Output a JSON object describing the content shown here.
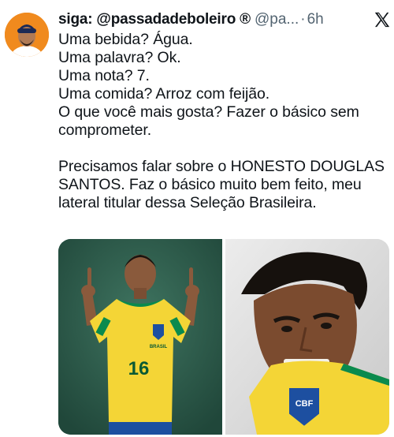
{
  "tweet": {
    "display_name": "siga: @passadadeboleiro ®",
    "handle": "@pa...",
    "separator": "·",
    "time": "6h",
    "lines": [
      "Uma bebida? Água.",
      "Uma palavra? Ok.",
      "Uma nota? 7.",
      "Uma comida? Arroz com feijão.",
      "O que você mais gosta? Fazer o básico sem",
      "comprometer."
    ],
    "paragraph2": [
      "Precisamos falar sobre o HONESTO DOUGLAS",
      "SANTOS. Faz o básico muito bem feito, meu",
      "lateral titular dessa Seleção Brasileira."
    ],
    "media": {
      "left_jersey_number": "16",
      "left_jersey_text": "BRASIL",
      "right_badge_text": "CBF"
    }
  },
  "colors": {
    "accent_orange": "#f08a1e",
    "jersey_yellow": "#f4d536",
    "jersey_green": "#0a8a4e",
    "text_secondary": "#536471"
  },
  "icons": {
    "platform": "x-logo-icon",
    "avatar": "avatar"
  }
}
